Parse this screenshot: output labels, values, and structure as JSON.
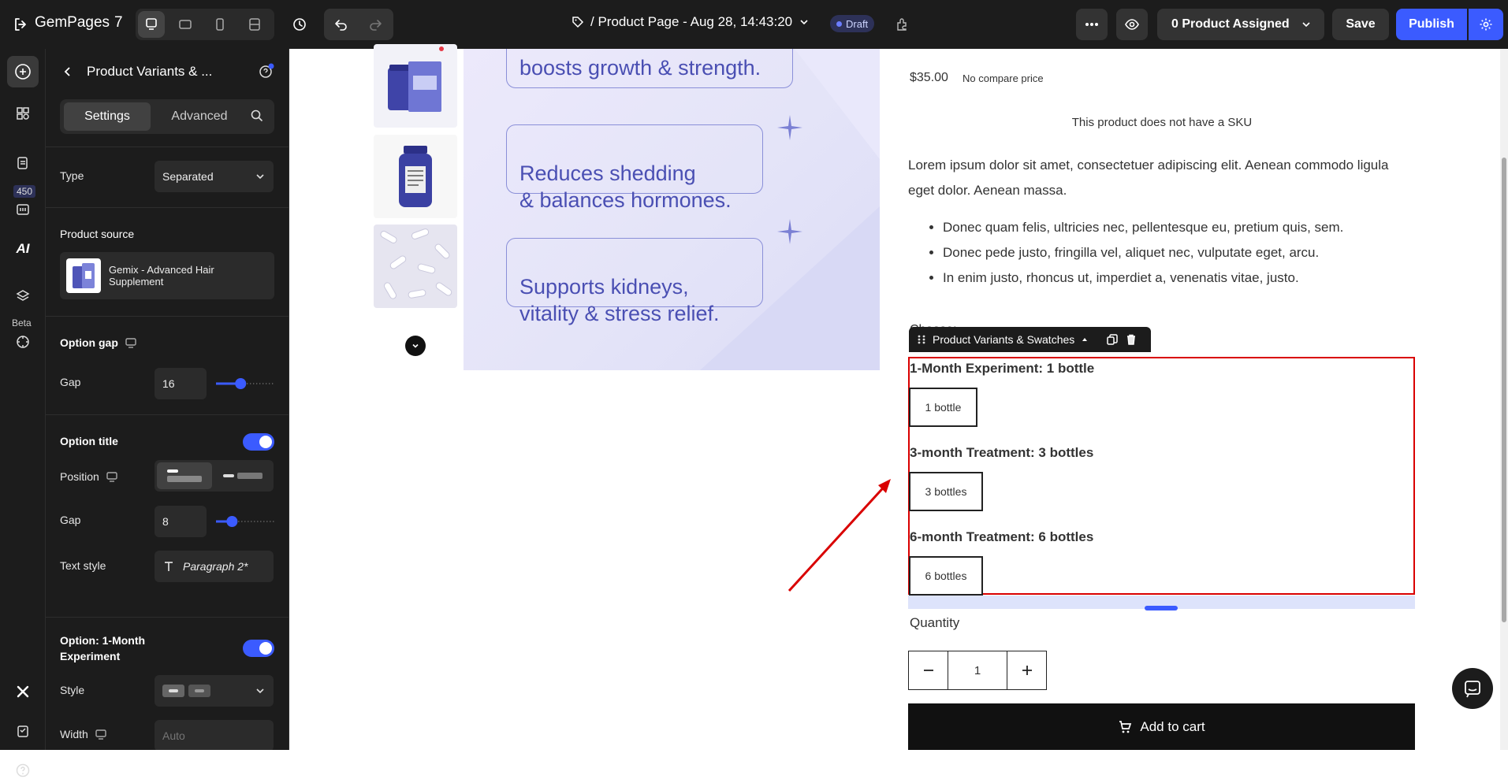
{
  "app": {
    "name": "GemPages",
    "version": "7"
  },
  "topbar": {
    "page_title": "/ Product Page - Aug 28, 14:43:20",
    "status_badge": "Draft",
    "product_assigned": "0 Product Assigned",
    "save_label": "Save",
    "publish_label": "Publish"
  },
  "rail": {
    "count_badge": "450",
    "ai_label": "AI",
    "beta_label": "Beta"
  },
  "panel": {
    "title": "Product Variants & ...",
    "tabs": [
      "Settings",
      "Advanced"
    ],
    "type_label": "Type",
    "type_value": "Separated",
    "product_source_label": "Product source",
    "product_source_value": "Gemix - Advanced Hair Supplement",
    "option_gap_label": "Option gap",
    "gap_label": "Gap",
    "gap_value": "16",
    "gap_slider_fraction": 0.43,
    "option_title_label": "Option title",
    "option_title_enabled": true,
    "position_label": "Position",
    "title_gap_label": "Gap",
    "title_gap_value": "8",
    "title_gap_slider_fraction": 0.27,
    "text_style_label": "Text style",
    "text_style_value": "Paragraph 2*",
    "option_1_label": "Option: 1-Month Experiment",
    "option_1_enabled": true,
    "style_label": "Style",
    "width_label": "Width",
    "width_placeholder": "Auto"
  },
  "product": {
    "hero_lines": [
      "boosts growth & strength.",
      "Reduces shedding\n& balances hormones.",
      "Supports kidneys,\nvitality & stress relief."
    ],
    "price": "$35.00",
    "compare_price": "No compare price",
    "sku_text": "This product does not have a SKU",
    "description": "Lorem ipsum dolor sit amet, consectetuer adipiscing elit. Aenean commodo ligula eget dolor. Aenean massa.",
    "bullets": [
      "Donec quam felis, ultricies nec, pellentesque eu, pretium quis, sem.",
      "Donec pede justo, fringilla vel, aliquet nec, vulputate eget, arcu.",
      "In enim justo, rhoncus ut, imperdiet a, venenatis vitae, justo."
    ],
    "hidden_label": "Choose:",
    "element_toolbar_label": "Product Variants & Swatches",
    "options": [
      {
        "title": "1-Month Experiment: 1 bottle",
        "value": "1 bottle"
      },
      {
        "title": "3-month Treatment: 3 bottles",
        "value": "3 bottles"
      },
      {
        "title": "6-month Treatment: 6 bottles",
        "value": "6 bottles"
      }
    ],
    "quantity_label": "Quantity",
    "quantity_value": "1",
    "add_to_cart": "Add to cart"
  },
  "colors": {
    "accent": "#3b5bff",
    "highlight": "#d90000",
    "dark": "#1c1c1c"
  }
}
